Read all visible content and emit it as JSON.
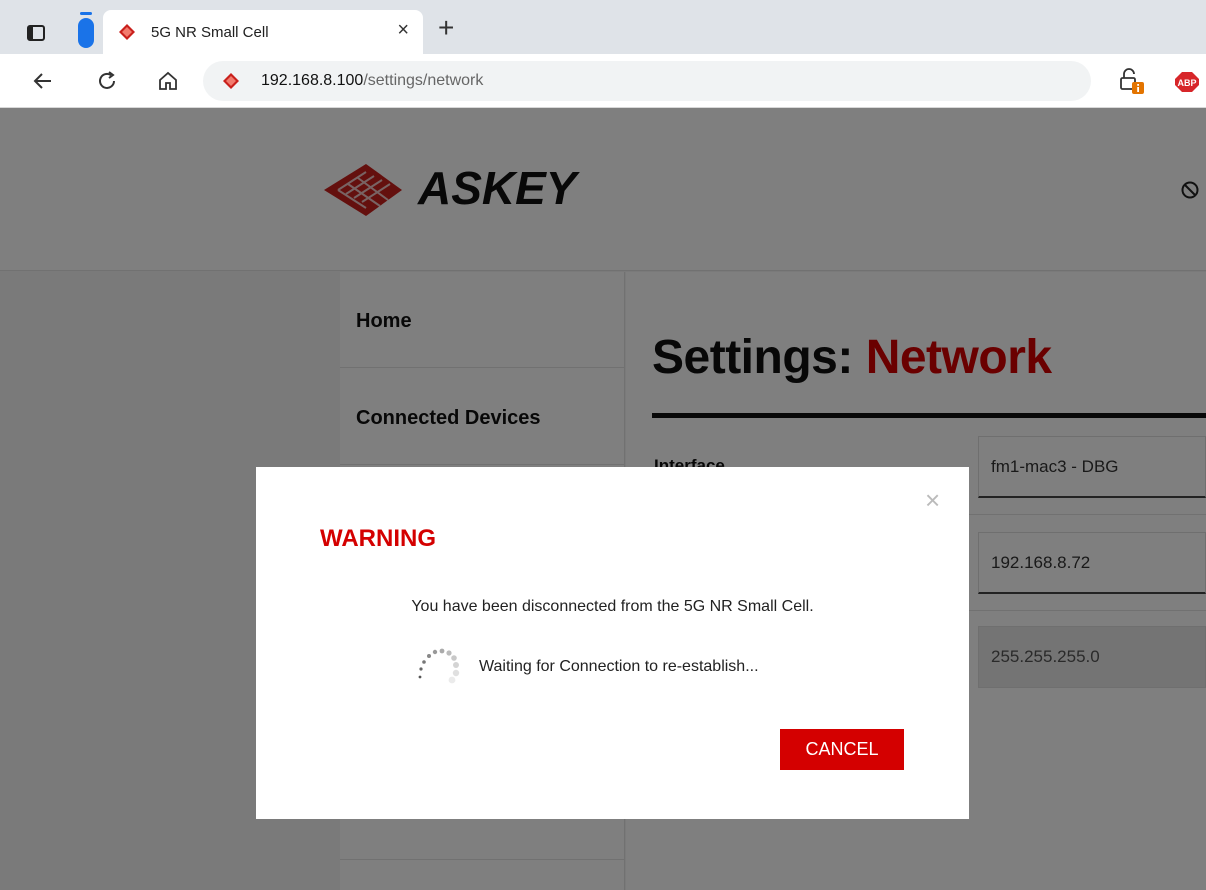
{
  "browser": {
    "tab": {
      "title": "5G NR Small Cell",
      "close_glyph": "×"
    },
    "new_tab_glyph": "+",
    "address": {
      "host": "192.168.8.100",
      "path": "/settings/network"
    },
    "extensions": {
      "adblock_label": "ABP"
    },
    "icons": [
      "sidebar-icon",
      "vertical-tabs-icon",
      "back-icon",
      "reload-icon",
      "home-icon",
      "site-info-icon",
      "adblock-icon"
    ]
  },
  "page": {
    "logo_text": "ASKEY",
    "sidebar": {
      "items": [
        {
          "label": "Home"
        },
        {
          "label": "Connected Devices"
        }
      ]
    },
    "title_prefix": "Settings:",
    "title_accent": "Network",
    "form": {
      "interface_label": "Interface",
      "interface_value": "fm1-mac3 - DBG",
      "ip_value": "192.168.8.72",
      "netmask_value": "255.255.255.0"
    }
  },
  "modal": {
    "title": "WARNING",
    "close_glyph": "×",
    "message": "You have been disconnected from the 5G NR Small Cell.",
    "waiting_text": "Waiting for Connection to re-establish...",
    "cancel_label": "CANCEL"
  },
  "colors": {
    "accent": "#d40000",
    "overlay": "rgba(0,0,0,0.5)"
  }
}
